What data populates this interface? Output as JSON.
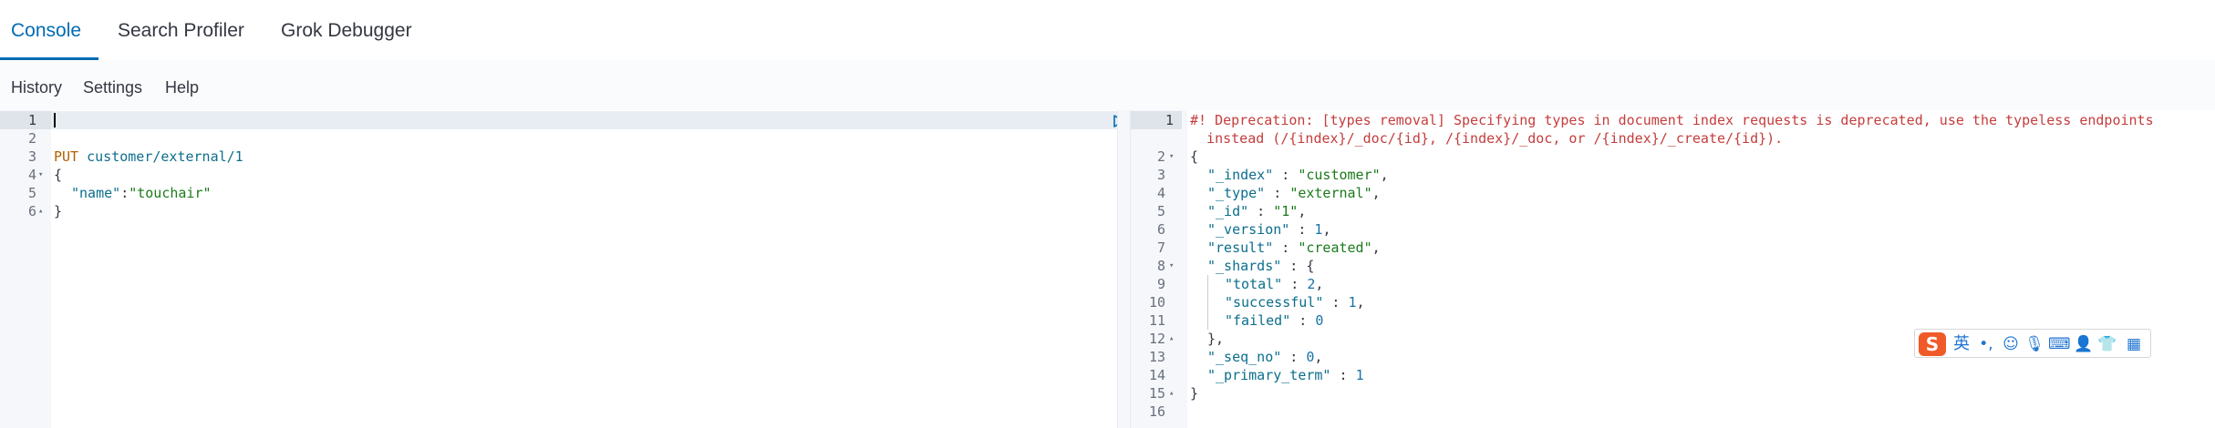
{
  "tabs": [
    {
      "label": "Console",
      "active": true
    },
    {
      "label": "Search Profiler",
      "active": false
    },
    {
      "label": "Grok Debugger",
      "active": false
    }
  ],
  "subnav": {
    "history": "History",
    "settings": "Settings",
    "help": "Help"
  },
  "request_editor": {
    "line_numbers": [
      "1",
      "2",
      "3",
      "4",
      "5",
      "6"
    ],
    "fold_markers": {
      "4": "open",
      "6": "close"
    },
    "lines": {
      "method": "PUT",
      "url": " customer/external/1",
      "open_brace": "{",
      "key_name": "\"name\"",
      "colon": ":",
      "value_name": "\"touchair\"",
      "close_brace": "}"
    },
    "actions": {
      "run_icon": "play-icon",
      "settings_icon": "wrench-icon"
    }
  },
  "response_editor": {
    "line_numbers": [
      "1",
      "",
      "2",
      "3",
      "4",
      "5",
      "6",
      "7",
      "8",
      "9",
      "10",
      "11",
      "12",
      "13",
      "14",
      "15",
      "16"
    ],
    "warning_line1": "#! Deprecation: [types removal] Specifying types in document index requests is deprecated, use the typeless endpoints",
    "warning_line2": "  instead (/{index}/_doc/{id}, /{index}/_doc, or /{index}/_create/{id}).",
    "open_brace": "{",
    "fields": {
      "index_key": "\"_index\"",
      "index_val": "\"customer\"",
      "type_key": "\"_type\"",
      "type_val": "\"external\"",
      "id_key": "\"_id\"",
      "id_val": "\"1\"",
      "version_key": "\"_version\"",
      "version_val": "1",
      "result_key": "\"result\"",
      "result_val": "\"created\"",
      "shards_key": "\"_shards\"",
      "total_key": "\"total\"",
      "total_val": "2",
      "successful_key": "\"successful\"",
      "successful_val": "1",
      "failed_key": "\"failed\"",
      "failed_val": "0",
      "seq_key": "\"_seq_no\"",
      "seq_val": "0",
      "primary_key": "\"_primary_term\"",
      "primary_val": "1"
    },
    "close_inner": "},",
    "close_brace": "}"
  },
  "ime_toolbar": {
    "logo": "S",
    "lang": "英",
    "items": [
      "punct-icon",
      "emoji-icon",
      "mic-icon",
      "keyboard-icon",
      "user-icon",
      "skin-icon",
      "grid-icon"
    ]
  },
  "colors": {
    "accent": "#006bb4",
    "warning": "#c43d3d",
    "ime_logo": "#f05a28"
  }
}
